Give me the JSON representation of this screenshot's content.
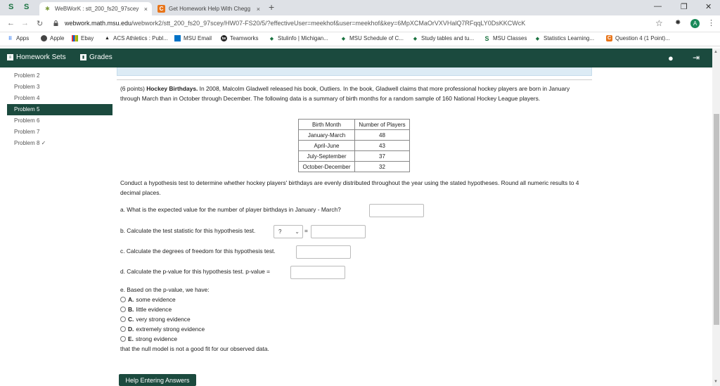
{
  "browser": {
    "pinned_tabs": [
      "S",
      "S"
    ],
    "tabs": [
      {
        "title": "WeBWorK : stt_200_fs20_97scey",
        "close": "×"
      },
      {
        "title": "Get Homework Help With Chegg",
        "close": "×"
      }
    ],
    "new_tab": "+",
    "window_controls": {
      "minimize": "—",
      "maximize": "❐",
      "close": "✕"
    },
    "url_host": "webwork.math.msu.edu",
    "url_path": "/webwork2/stt_200_fs20_97scey/HW07-FS20/5/?effectiveUser=meekhof&user=meekhof&key=6MpXCMaOrVXVHalQ7RFqqLY0DsKKCWcK",
    "profile_initial": "A",
    "bookmarks": [
      {
        "label": "Apps",
        "icon": "⠿"
      },
      {
        "label": "Apple",
        "icon": ""
      },
      {
        "label": "Ebay",
        "icon": ""
      },
      {
        "label": "ACS Athletics : Publ...",
        "icon": "▲"
      },
      {
        "label": "MSU Email",
        "icon": ""
      },
      {
        "label": "Teamworks",
        "icon": "tw"
      },
      {
        "label": "Stulinfo | Michigan...",
        "icon": ""
      },
      {
        "label": "MSU Schedule of C...",
        "icon": ""
      },
      {
        "label": "Study tables and tu...",
        "icon": ""
      },
      {
        "label": "MSU Classes",
        "icon": "S"
      },
      {
        "label": "Statistics Learning...",
        "icon": ""
      },
      {
        "label": "Question 4 (1 Point)...",
        "icon": "C"
      }
    ]
  },
  "appbar": {
    "homework_sets": "Homework Sets",
    "grades": "Grades"
  },
  "sidebar": {
    "items": [
      {
        "label": "Problem 2"
      },
      {
        "label": "Problem 3"
      },
      {
        "label": "Problem 4"
      },
      {
        "label": "Problem 5"
      },
      {
        "label": "Problem 6"
      },
      {
        "label": "Problem 7"
      },
      {
        "label": "Problem 8 ✓"
      }
    ],
    "active_index": 3
  },
  "problem": {
    "points": "(6 points)",
    "title": "Hockey Birthdays.",
    "text": "In 2008, Malcolm Gladwell released his book, Outliers. In the book, Gladwell claims that more professional hockey players are born in January through March than in October through December. The following data is a summary of birth months for a random sample of 160 National Hockey League players.",
    "table": {
      "headers": [
        "Birth Month",
        "Number of Players"
      ],
      "rows": [
        [
          "January-March",
          "48"
        ],
        [
          "April-June",
          "43"
        ],
        [
          "July-September",
          "37"
        ],
        [
          "October-December",
          "32"
        ]
      ]
    },
    "instructions": "Conduct a hypothesis test to determine whether hockey players' birthdays are evenly distributed throughout the year using the stated hypotheses. Round all numeric results to 4 decimal places.",
    "qa": "a. What is the expected value for the number of player birthdays in January - March?",
    "qb": "b. Calculate the test statistic for this hypothesis test.",
    "qb_select": "?",
    "qb_equals": "=",
    "qc": "c. Calculate the degrees of freedom for this hypothesis test.",
    "qd": "d. Calculate the p-value for this hypothesis test. p-value =",
    "qe": "e. Based on the p-value, we have:",
    "options": [
      {
        "letter": "A.",
        "text": "some evidence"
      },
      {
        "letter": "B.",
        "text": "little evidence"
      },
      {
        "letter": "C.",
        "text": "very strong evidence"
      },
      {
        "letter": "D.",
        "text": "extremely strong evidence"
      },
      {
        "letter": "E.",
        "text": "strong evidence"
      }
    ],
    "conclusion": "that the null model is not a good fit for our observed data."
  },
  "help_button": "Help Entering Answers"
}
